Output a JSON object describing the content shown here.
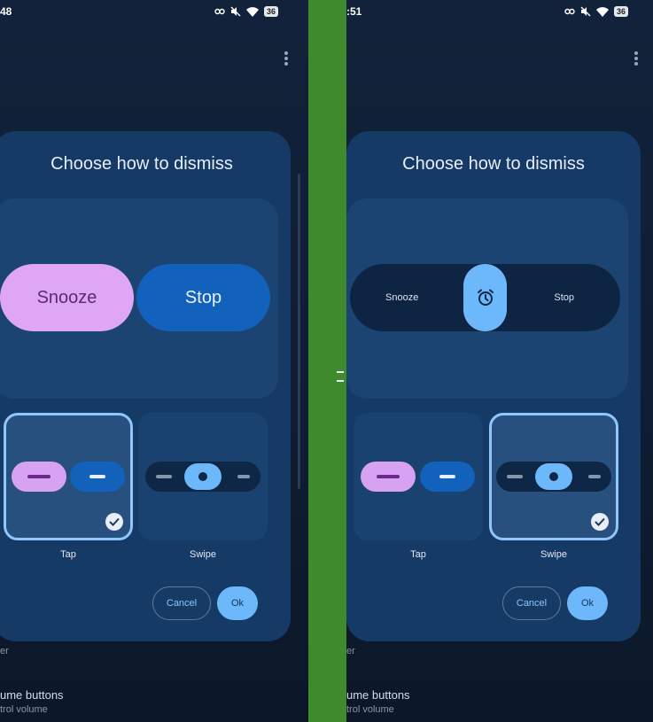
{
  "left": {
    "status_time": "48",
    "battery": "36",
    "dialog_title": "Choose how to dismiss",
    "preview": {
      "snooze_label": "Snooze",
      "stop_label": "Stop"
    },
    "options": [
      {
        "label": "Tap",
        "selected": true
      },
      {
        "label": "Swipe",
        "selected": false
      }
    ],
    "buttons": {
      "cancel": "Cancel",
      "ok": "Ok"
    },
    "background": {
      "line1": "er",
      "line2": "ume buttons",
      "line3": "trol volume"
    }
  },
  "right": {
    "status_time": ":51",
    "battery": "36",
    "dialog_title": "Choose how to dismiss",
    "preview": {
      "snooze_label": "Snooze",
      "stop_label": "Stop",
      "thumb_icon": "alarm-clock-icon"
    },
    "options": [
      {
        "label": "Tap",
        "selected": false
      },
      {
        "label": "Swipe",
        "selected": true
      }
    ],
    "buttons": {
      "cancel": "Cancel",
      "ok": "Ok"
    },
    "background": {
      "line1": "er",
      "line2": "ume buttons",
      "line3": "trol volume"
    }
  },
  "colors": {
    "divider": "#3f8a2d",
    "dialog_bg": "#163a66",
    "accent": "#6db8fb",
    "snooze_purple": "#dfa6f5",
    "stop_blue": "#1261bb"
  }
}
